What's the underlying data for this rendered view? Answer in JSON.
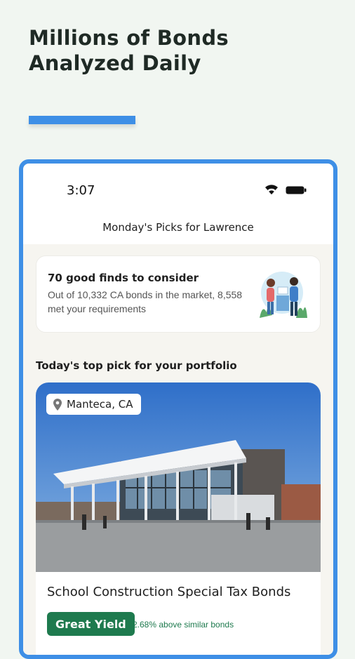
{
  "hero": {
    "line1": "Millions of Bonds",
    "line2": "Analyzed Daily"
  },
  "status_bar": {
    "time": "3:07"
  },
  "header": {
    "title": "Monday's Picks for Lawrence"
  },
  "finds_card": {
    "title": "70 good finds to consider",
    "subtitle": "Out of 10,332 CA bonds in the market, 8,558 met your requirements"
  },
  "section_title": "Today's top pick for your portfolio",
  "pick": {
    "location": "Manteca, CA",
    "bond_title": "School Construction Special Tax Bonds",
    "badge": "Great Yield",
    "yield_note": "2.68% above similar bonds"
  },
  "colors": {
    "accent_blue": "#3e8fe6",
    "badge_green": "#1e7a4e",
    "page_background": "#f1f6f1"
  }
}
